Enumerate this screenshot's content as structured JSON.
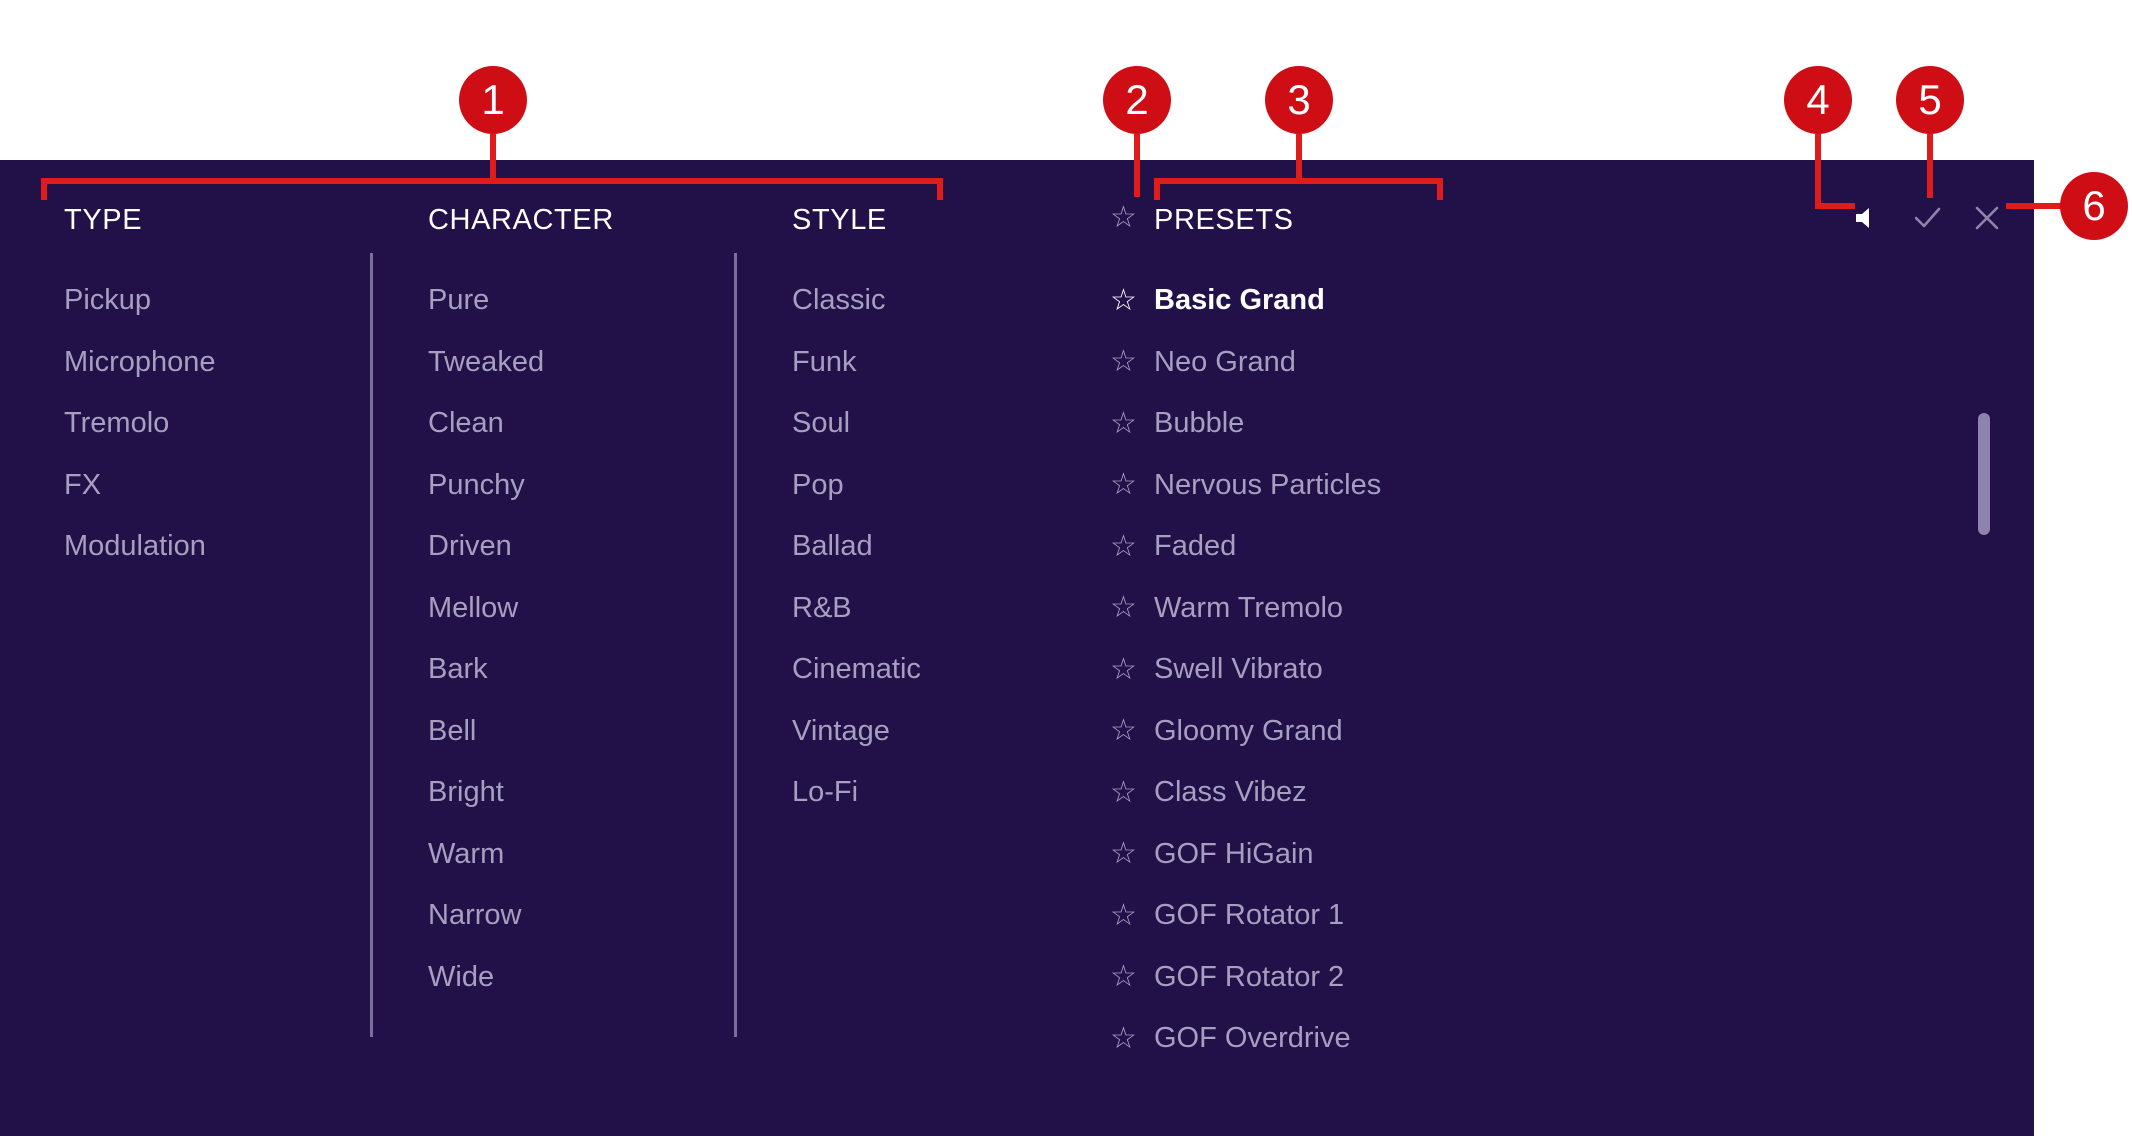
{
  "panel": {
    "name": "preset-browser",
    "background_color": "#221049",
    "text_color_dim": "#a69fc0",
    "text_color_bright": "#ffffff",
    "divider_color": "#7a6f9c"
  },
  "columns": {
    "type": {
      "header": "TYPE",
      "items": [
        "Pickup",
        "Microphone",
        "Tremolo",
        "FX",
        "Modulation"
      ]
    },
    "character": {
      "header": "CHARACTER",
      "items": [
        "Pure",
        "Tweaked",
        "Clean",
        "Punchy",
        "Driven",
        "Mellow",
        "Bark",
        "Bell",
        "Bright",
        "Warm",
        "Narrow",
        "Wide"
      ]
    },
    "style": {
      "header": "STYLE",
      "items": [
        "Classic",
        "Funk",
        "Soul",
        "Pop",
        "Ballad",
        "R&B",
        "Cinematic",
        "Vintage",
        "Lo-Fi"
      ]
    },
    "presets": {
      "header": "PRESETS",
      "star_glyph": "☆",
      "selected": "Basic Grand",
      "items": [
        "Basic Grand",
        "Neo Grand",
        "Bubble",
        "Nervous Particles",
        "Faded",
        "Warm Tremolo",
        "Swell Vibrato",
        "Gloomy Grand",
        "Class Vibez",
        "GOF HiGain",
        "GOF Rotator 1",
        "GOF Rotator 2",
        "GOF Overdrive"
      ]
    }
  },
  "toolbar": {
    "speaker_icon": "speaker-icon",
    "check_icon": "check-icon",
    "close_icon": "close-icon"
  },
  "scrollbar": {
    "thumb_color": "#8c84ad"
  },
  "annotations": {
    "accent_color": "#ce0d14",
    "callouts": [
      {
        "number": "1",
        "target": "column-headers-group"
      },
      {
        "number": "2",
        "target": "presets-header-star"
      },
      {
        "number": "3",
        "target": "presets-header"
      },
      {
        "number": "4",
        "target": "speaker-icon"
      },
      {
        "number": "5",
        "target": "check-icon"
      },
      {
        "number": "6",
        "target": "close-icon"
      }
    ]
  }
}
